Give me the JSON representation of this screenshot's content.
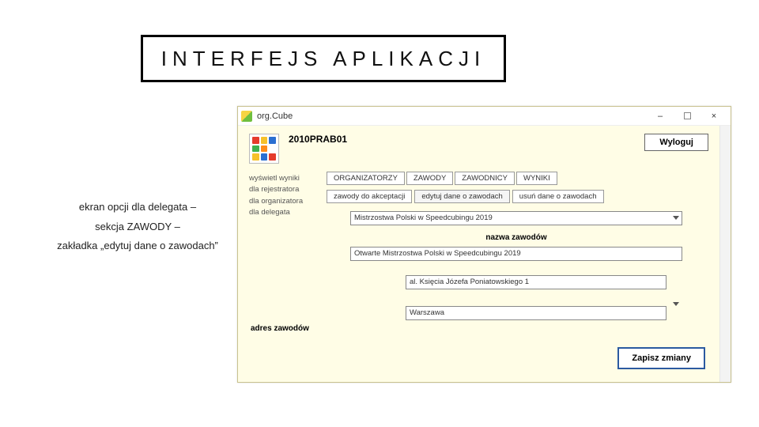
{
  "slide": {
    "title": "INTERFEJS APLIKACJI",
    "caption1": "ekran opcji dla delegata –",
    "caption2": "sekcja ZAWODY –",
    "caption3": "zakładka „edytuj dane o zawodach”"
  },
  "window": {
    "title": "org.Cube",
    "minimize": "–",
    "close": "×"
  },
  "header": {
    "user_code": "2010PRAB01",
    "logout": "Wyloguj"
  },
  "side_links": {
    "l1": "wyświetl wyniki",
    "l2": "dla rejestratora",
    "l3": "dla organizatora",
    "l4": "dla delegata"
  },
  "tabs": {
    "t1": "ORGANIZATORZY",
    "t2": "ZAWODY",
    "t3": "ZAWODNICY",
    "t4": "WYNIKI"
  },
  "subtabs": {
    "s1": "zawody do akceptacji",
    "s2": "edytuj dane o zawodach",
    "s3": "usuń dane o zawodach"
  },
  "form": {
    "event_select": "Mistrzostwa Polski w Speedcubingu 2019",
    "name_label": "nazwa zawodów",
    "name_value": "Otwarte Mistrzostwa Polski w Speedcubingu 2019",
    "street_value": "al. Księcia Józefa Poniatowskiego 1",
    "addr_label": "adres zawodów",
    "city_value": "Warszawa",
    "save": "Zapisz zmiany"
  },
  "cube_colors": [
    "#e53b2c",
    "#f6c12b",
    "#2b6fd1",
    "#3fb14f",
    "#ff8c1a",
    "#fff",
    "#f6c12b",
    "#2b6fd1",
    "#e53b2c"
  ]
}
